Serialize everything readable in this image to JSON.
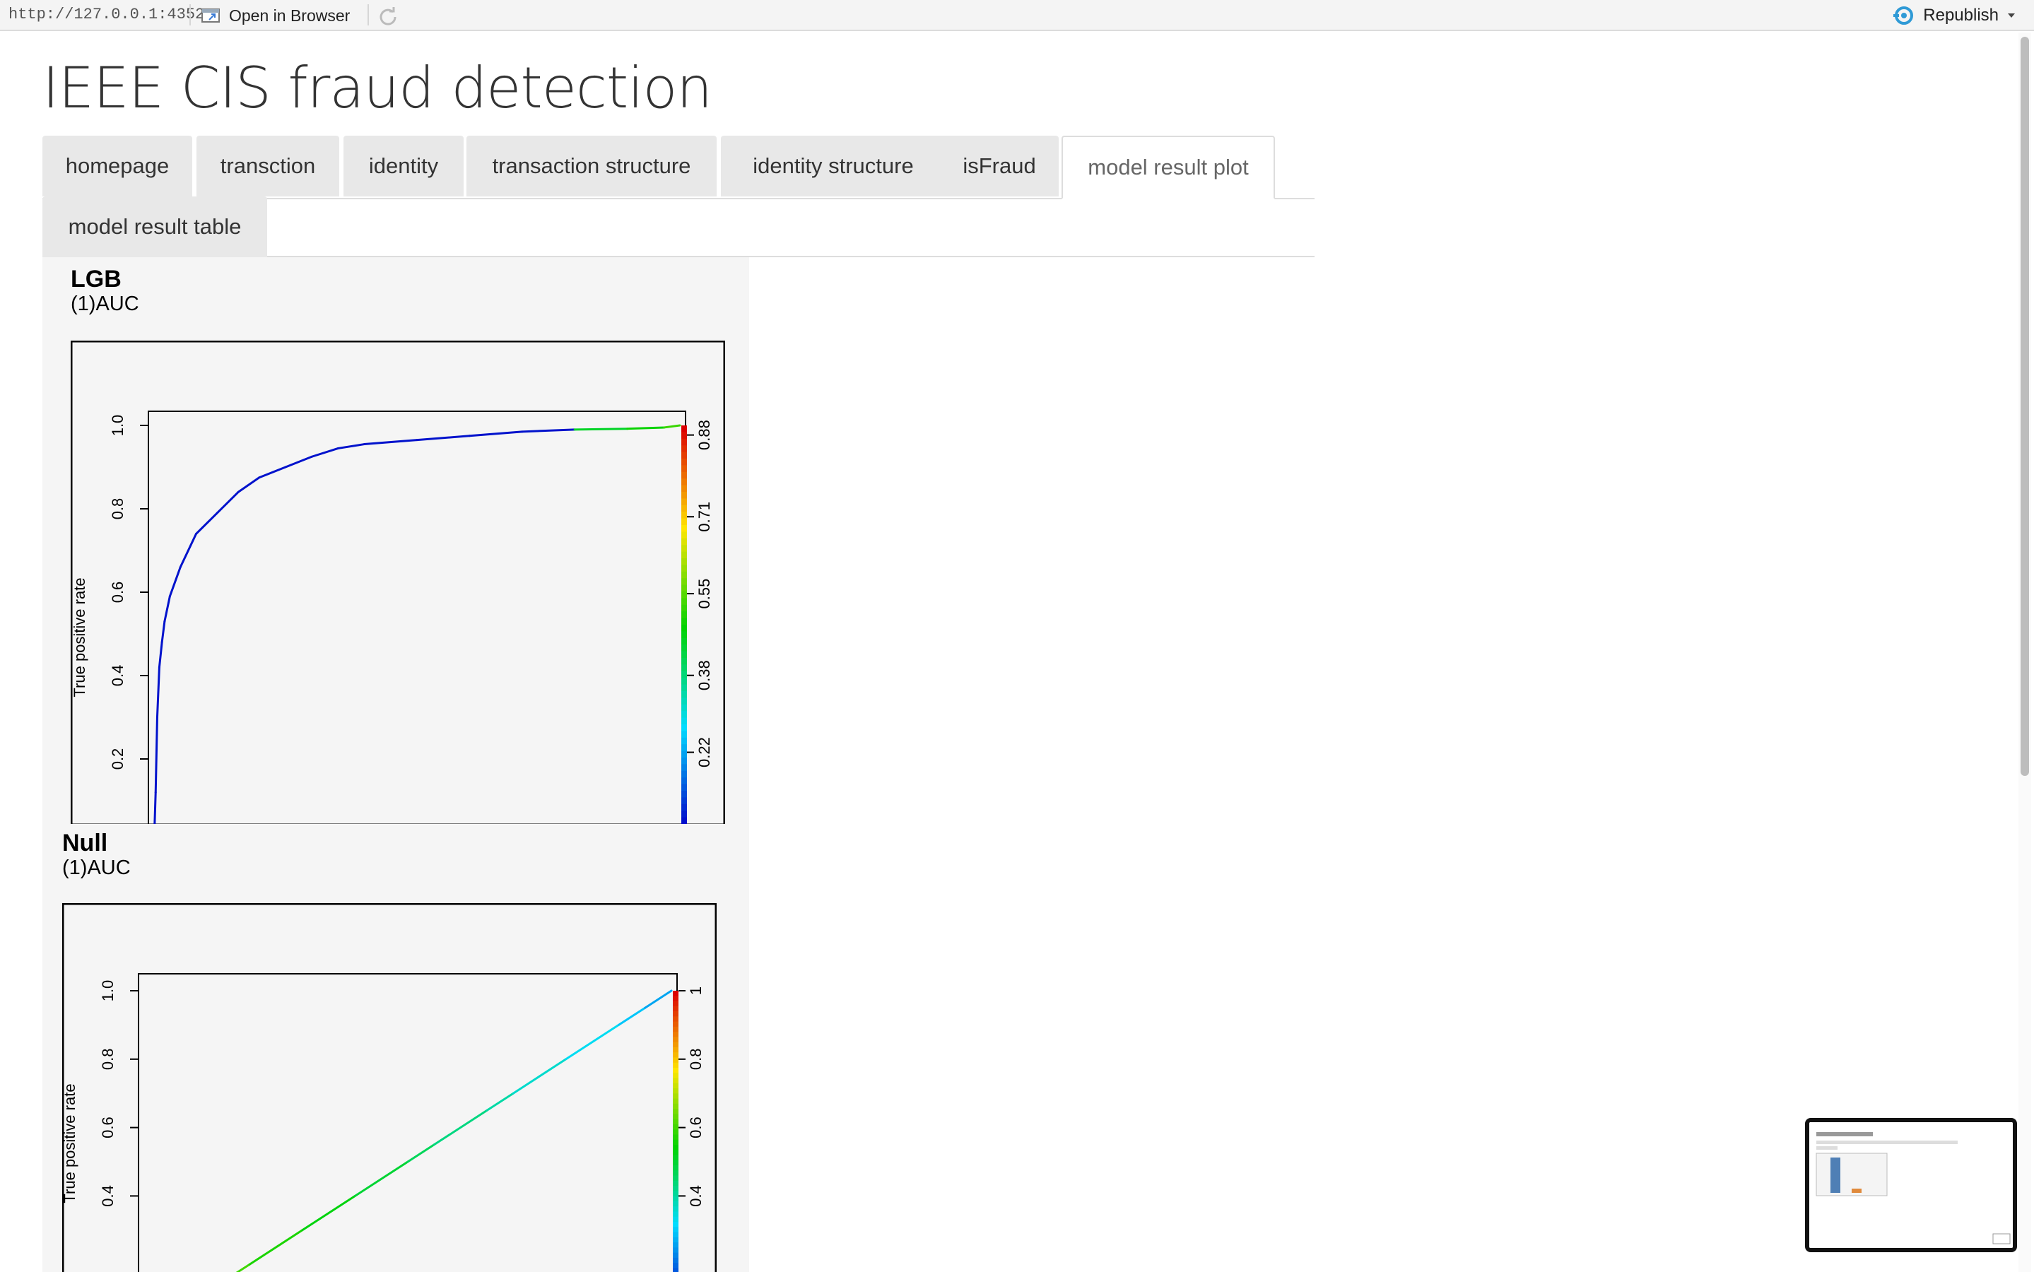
{
  "viewer": {
    "url": "http://127.0.0.1:4352",
    "open_in_browser": "Open in Browser",
    "republish": "Republish",
    "icons": [
      "browser-window-icon",
      "refresh-icon",
      "publish-icon",
      "dropdown-caret-icon"
    ]
  },
  "page": {
    "title": "IEEE CIS fraud detection",
    "active_tab": "model result plot",
    "tabs": [
      {
        "label": "homepage"
      },
      {
        "label": "transction"
      },
      {
        "label": "identity"
      },
      {
        "label": "transaction structure"
      },
      {
        "label": "identity structure"
      },
      {
        "label": "isFraud"
      },
      {
        "label": "model result plot"
      },
      {
        "label": "model result table"
      }
    ]
  },
  "plots": [
    {
      "title": "LGB",
      "subtitle": "(1)AUC"
    },
    {
      "title": "Null",
      "subtitle": "(1)AUC"
    }
  ],
  "chart_data": [
    {
      "type": "line",
      "title": "",
      "ylabel": "True positive rate",
      "xlabel": "",
      "xlim": [
        0,
        1
      ],
      "ylim": [
        0,
        1
      ],
      "y_ticks": [
        "0.2",
        "0.4",
        "0.6",
        "0.8",
        "1.0"
      ],
      "colorbar_ticks": [
        "0.22",
        "0.38",
        "0.55",
        "0.71",
        "0.88"
      ],
      "x": [
        0.0,
        0.003,
        0.006,
        0.01,
        0.015,
        0.02,
        0.03,
        0.05,
        0.08,
        0.12,
        0.16,
        0.2,
        0.25,
        0.3,
        0.35,
        0.4,
        0.5,
        0.6,
        0.7,
        0.8,
        0.9,
        0.97,
        1.0
      ],
      "y": [
        0.0,
        0.12,
        0.3,
        0.42,
        0.48,
        0.53,
        0.59,
        0.66,
        0.74,
        0.79,
        0.84,
        0.875,
        0.9,
        0.925,
        0.945,
        0.955,
        0.965,
        0.975,
        0.985,
        0.99,
        0.992,
        0.995,
        1.0
      ]
    },
    {
      "type": "line",
      "title": "",
      "ylabel": "True positive rate",
      "xlabel": "",
      "xlim": [
        0,
        1
      ],
      "ylim": [
        0,
        1
      ],
      "y_ticks": [
        "0.4",
        "0.6",
        "0.8",
        "1.0"
      ],
      "colorbar_ticks": [
        "0.4",
        "0.6",
        "0.8",
        "1"
      ],
      "x": [
        0.0,
        0.1,
        0.2,
        0.3,
        0.4,
        0.5,
        0.55,
        0.65,
        0.7,
        0.8,
        0.9,
        0.95,
        1.0
      ],
      "y": [
        0.0,
        0.1,
        0.2,
        0.3,
        0.4,
        0.5,
        0.55,
        0.65,
        0.7,
        0.8,
        0.9,
        0.95,
        1.0
      ]
    }
  ]
}
